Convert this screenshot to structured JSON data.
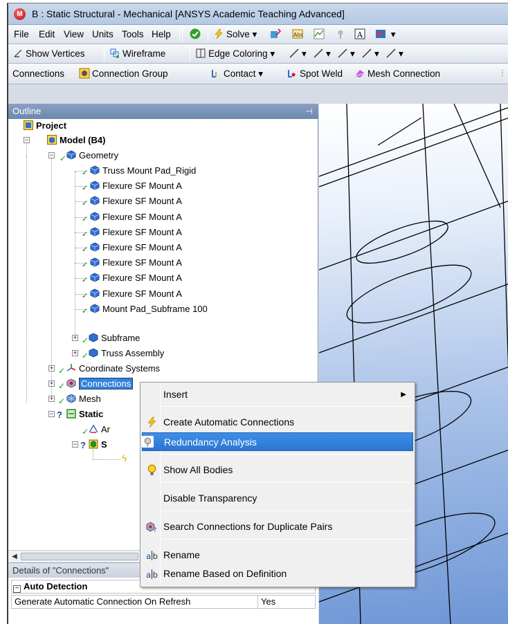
{
  "window": {
    "title": "B : Static Structural - Mechanical [ANSYS Academic Teaching Advanced]",
    "logo": "M"
  },
  "menubar": {
    "file": "File",
    "edit": "Edit",
    "view": "View",
    "units": "Units",
    "tools": "Tools",
    "help": "Help",
    "solve": "Solve"
  },
  "toolbar2": {
    "show_vertices": "Show Vertices",
    "wireframe": "Wireframe",
    "edge_coloring": "Edge Coloring"
  },
  "toolbar3": {
    "connections": "Connections",
    "connection_group": "Connection Group",
    "contact": "Contact",
    "spot_weld": "Spot Weld",
    "mesh_connection": "Mesh Connection"
  },
  "outline": {
    "header": "Outline",
    "project": "Project",
    "model": "Model (B4)",
    "geometry": "Geometry",
    "geometry_items": [
      "Truss Mount Pad_Rigid",
      "Flexure SF Mount A",
      "Flexure SF Mount A",
      "Flexure SF Mount A",
      "Flexure SF Mount A",
      "Flexure SF Mount A",
      "Flexure SF Mount A",
      "Flexure SF Mount A",
      "Flexure SF Mount A",
      "Mount Pad_Subframe 100"
    ],
    "subframe": "Subframe",
    "truss_assembly": "Truss Assembly",
    "coordinate_systems": "Coordinate Systems",
    "connections": "Connections",
    "mesh": "Mesh",
    "static": "Static",
    "analysis_settings_partial": "Ar",
    "solution_partial": "S"
  },
  "details": {
    "header": "Details of \"Connections\"",
    "section": "Auto Detection",
    "row_label": "Generate Automatic Connection On Refresh",
    "row_value": "Yes"
  },
  "context_menu": {
    "insert": "Insert",
    "create_auto": "Create Automatic Connections",
    "redundancy": "Redundancy Analysis",
    "show_all": "Show All Bodies",
    "disable_transparency": "Disable Transparency",
    "search_duplicates": "Search Connections for Duplicate Pairs",
    "rename": "Rename",
    "rename_definition": "Rename Based on Definition"
  },
  "colors": {
    "outline_header": "#7a92b8",
    "highlight": "#3482dc",
    "check_green": "#1a9e1a",
    "geometry_blue": "#2f6fcf"
  }
}
